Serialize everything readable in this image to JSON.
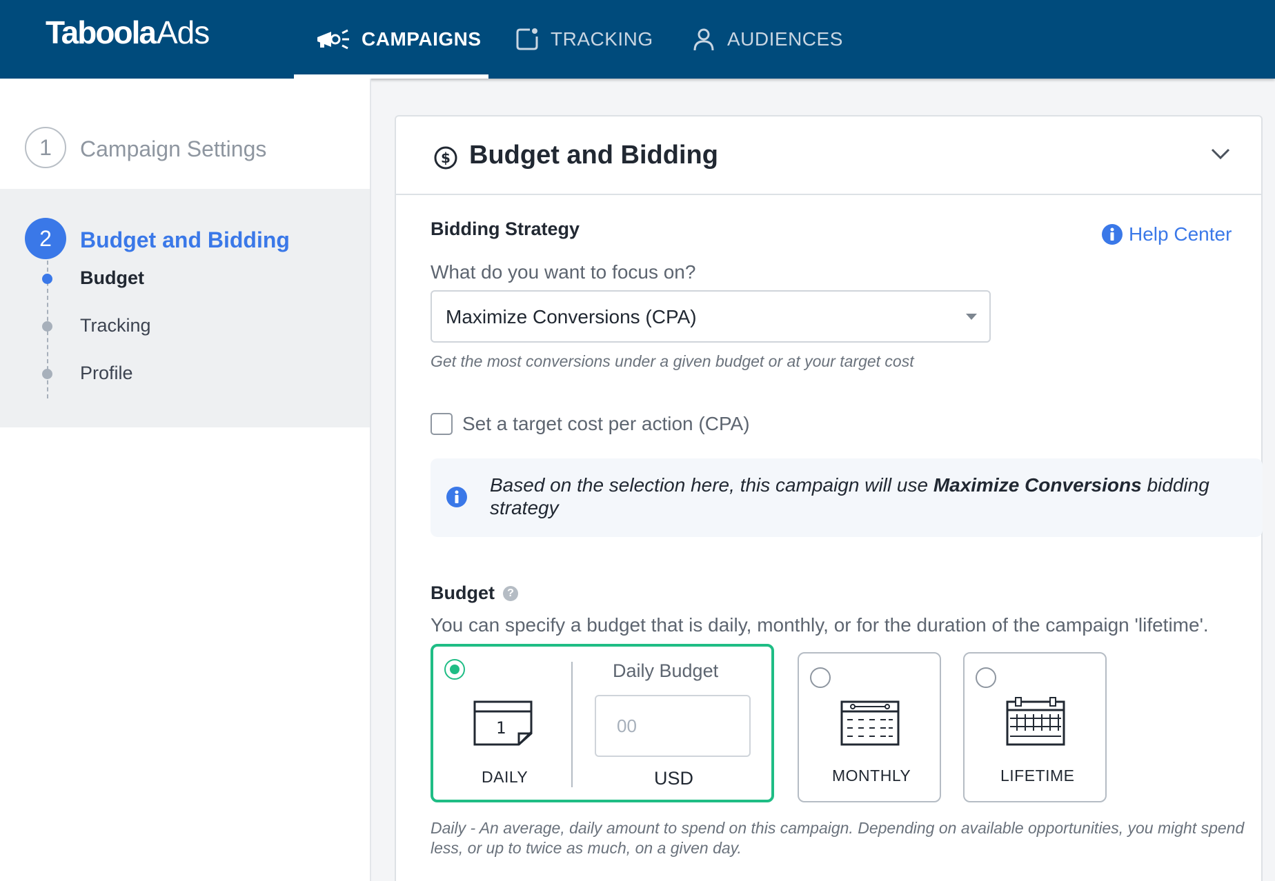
{
  "nav": {
    "logo_main": "Taboola",
    "logo_sub": "Ads",
    "items": [
      {
        "label": "CAMPAIGNS",
        "icon": "megaphone-icon",
        "active": true
      },
      {
        "label": "TRACKING",
        "icon": "tracking-icon",
        "active": false
      },
      {
        "label": "AUDIENCES",
        "icon": "user-icon",
        "active": false
      }
    ]
  },
  "sidebar": {
    "steps": [
      {
        "number": "1",
        "label": "Campaign Settings"
      },
      {
        "number": "2",
        "label": "Budget and Bidding"
      }
    ],
    "substeps": [
      {
        "label": "Budget",
        "active": true
      },
      {
        "label": "Tracking",
        "active": false
      },
      {
        "label": "Profile",
        "active": false
      }
    ]
  },
  "card": {
    "title": "Budget and Bidding",
    "bidding": {
      "title": "Bidding Strategy",
      "help_label": "Help Center",
      "question": "What do you want to focus on?",
      "selected": "Maximize Conversions (CPA)",
      "hint": "Get the most conversions under a given budget or at your target cost",
      "checkbox_label": "Set a target cost per action (CPA)",
      "checkbox_checked": false,
      "info_prefix": "Based on the selection here, this campaign will use ",
      "info_bold": "Maximize Conversions",
      "info_suffix": " bidding strategy"
    },
    "budget": {
      "title": "Budget",
      "description": "You can specify a budget that is daily, monthly, or for the duration of the campaign 'lifetime'.",
      "options": [
        {
          "label": "DAILY",
          "icon": "daily-calendar-icon",
          "selected": true,
          "calendar_day": "1"
        },
        {
          "label": "MONTHLY",
          "icon": "monthly-calendar-icon",
          "selected": false
        },
        {
          "label": "LIFETIME",
          "icon": "lifetime-calendar-icon",
          "selected": false
        }
      ],
      "daily_budget_title": "Daily Budget",
      "daily_budget_placeholder": "00",
      "currency": "USD",
      "footnote": "Daily - An average, daily amount to spend on this campaign. Depending on available opportunities, you might spend less, or up to twice as much, on a given day."
    }
  },
  "colors": {
    "nav_bg": "#004b7c",
    "accent_blue": "#3a78e8",
    "selected_green": "#1fbd85"
  }
}
